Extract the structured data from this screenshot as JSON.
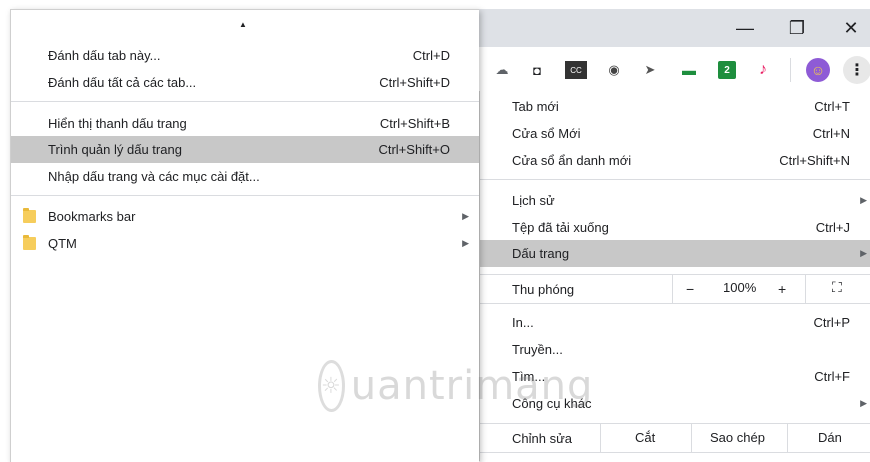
{
  "window": {
    "minimize_glyph": "—",
    "restore_glyph": "❐",
    "close_glyph": "✕"
  },
  "toolbar": {
    "extensions": [
      {
        "icon": "cloud-download-icon",
        "glyph": "☁"
      },
      {
        "icon": "camera-icon",
        "glyph": "◘"
      },
      {
        "icon": "seek-cc-icon",
        "glyph": "CC"
      },
      {
        "icon": "eye-icon",
        "glyph": "◉"
      },
      {
        "icon": "send-icon",
        "glyph": "➤"
      },
      {
        "icon": "caption-icon",
        "glyph": "▬"
      },
      {
        "icon": "notes-icon",
        "glyph": "2"
      },
      {
        "icon": "music-note-icon",
        "glyph": "♪"
      },
      {
        "icon": "profile-avatar-icon",
        "glyph": "☺"
      },
      {
        "icon": "more-menu-icon",
        "glyph": "⋮"
      }
    ]
  },
  "main_menu": {
    "new_tab": {
      "label": "Tab mới",
      "shortcut": "Ctrl+T"
    },
    "new_window": {
      "label": "Cửa sổ Mới",
      "shortcut": "Ctrl+N"
    },
    "incognito": {
      "label": "Cửa sổ ẩn danh mới",
      "shortcut": "Ctrl+Shift+N"
    },
    "history": {
      "label": "Lịch sử"
    },
    "downloads": {
      "label": "Tệp đã tải xuống",
      "shortcut": "Ctrl+J"
    },
    "bookmarks": {
      "label": "Dấu trang"
    },
    "zoom": {
      "label": "Thu phóng",
      "minus": "−",
      "value": "100%",
      "plus": "+",
      "fullscreen": "⛶"
    },
    "print": {
      "label": "In...",
      "shortcut": "Ctrl+P"
    },
    "cast": {
      "label": "Truyền..."
    },
    "find": {
      "label": "Tìm...",
      "shortcut": "Ctrl+F"
    },
    "more_tools": {
      "label": "Công cụ khác"
    },
    "edit": {
      "label": "Chỉnh sửa",
      "cut": "Cắt",
      "copy": "Sao chép",
      "paste": "Dán"
    }
  },
  "bookmarks_menu": {
    "scroll_up": "▲",
    "bookmark_tab": {
      "label": "Đánh dấu tab này...",
      "shortcut": "Ctrl+D"
    },
    "bookmark_all": {
      "label": "Đánh dấu tất cả các tab...",
      "shortcut": "Ctrl+Shift+D"
    },
    "show_bar": {
      "label": "Hiển thị thanh dấu trang",
      "shortcut": "Ctrl+Shift+B"
    },
    "manager": {
      "label": "Trình quản lý dấu trang",
      "shortcut": "Ctrl+Shift+O"
    },
    "import": {
      "label": "Nhập dấu trang và các mục cài đặt..."
    },
    "folders": [
      {
        "label": "Bookmarks bar"
      },
      {
        "label": "QTM"
      }
    ]
  },
  "watermark": {
    "text": "uantrimang"
  },
  "submenu_arrow": "▶"
}
